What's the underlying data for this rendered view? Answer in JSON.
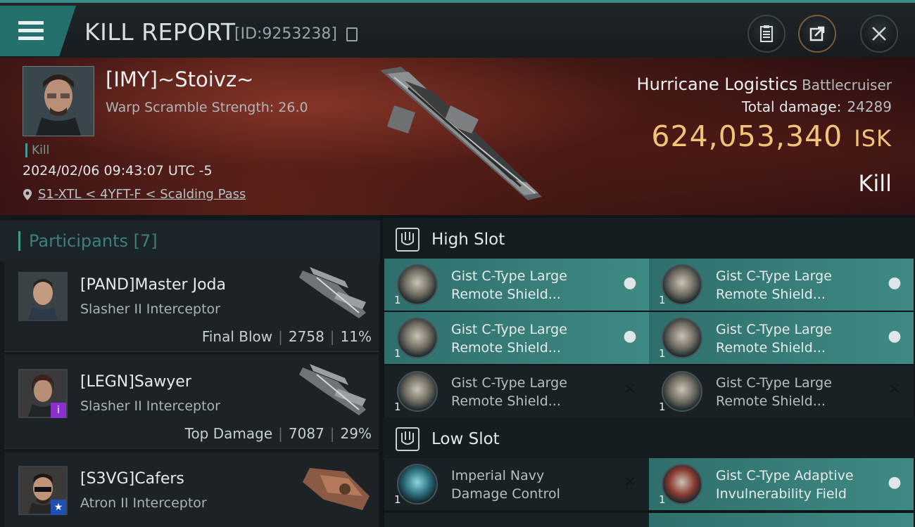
{
  "header": {
    "title": "KILL REPORT",
    "report_id": "[ID:9253238]"
  },
  "victim": {
    "name": "[IMY]~Stoivz~",
    "stat": "Warp Scramble Strength: 26.0",
    "tag": "Kill",
    "timestamp": "2024/02/06 09:43:07 UTC -5",
    "location": "S1-XTL < 4YFT-F < Scalding Pass",
    "ship_name": "Hurricane Logistics",
    "ship_class": "Battlecruiser",
    "total_damage_label": "Total damage:",
    "total_damage": "24289",
    "isk_value": "624,053,340",
    "isk_unit": "ISK",
    "result": "Kill"
  },
  "participants": {
    "label": "Participants",
    "count": "[7]",
    "items": [
      {
        "name": "[PAND]Master Joda",
        "ship": "Slasher II Interceptor",
        "role": "Final Blow",
        "damage": "2758",
        "percent": "11%"
      },
      {
        "name": "[LEGN]Sawyer",
        "ship": "Slasher II Interceptor",
        "role": "Top Damage",
        "damage": "7087",
        "percent": "29%"
      },
      {
        "name": "[S3VG]Cafers",
        "ship": "Atron II Interceptor"
      }
    ]
  },
  "high_slot": {
    "label": "High Slot",
    "modules": [
      {
        "qty": "1",
        "line1": "Gist C-Type Large",
        "line2": "Remote Shield...",
        "state": "active"
      },
      {
        "qty": "1",
        "line1": "Gist C-Type Large",
        "line2": "Remote Shield...",
        "state": "active"
      },
      {
        "qty": "1",
        "line1": "Gist C-Type Large",
        "line2": "Remote Shield...",
        "state": "active"
      },
      {
        "qty": "1",
        "line1": "Gist C-Type Large",
        "line2": "Remote Shield...",
        "state": "active"
      },
      {
        "qty": "1",
        "line1": "Gist C-Type Large",
        "line2": "Remote Shield...",
        "state": "destroyed"
      },
      {
        "qty": "1",
        "line1": "Gist C-Type Large",
        "line2": "Remote Shield...",
        "state": "destroyed"
      }
    ]
  },
  "low_slot": {
    "label": "Low Slot",
    "modules": [
      {
        "qty": "1",
        "line1": "Imperial Navy",
        "line2": "Damage Control",
        "state": "destroyed"
      },
      {
        "qty": "1",
        "line1": "Gist C-Type Adaptive",
        "line2": "Invulnerability Field",
        "state": "active"
      }
    ]
  },
  "colors": {
    "accent": "#3f9a8f",
    "isk": "#f2c477",
    "active_module": "#3f8a84"
  }
}
